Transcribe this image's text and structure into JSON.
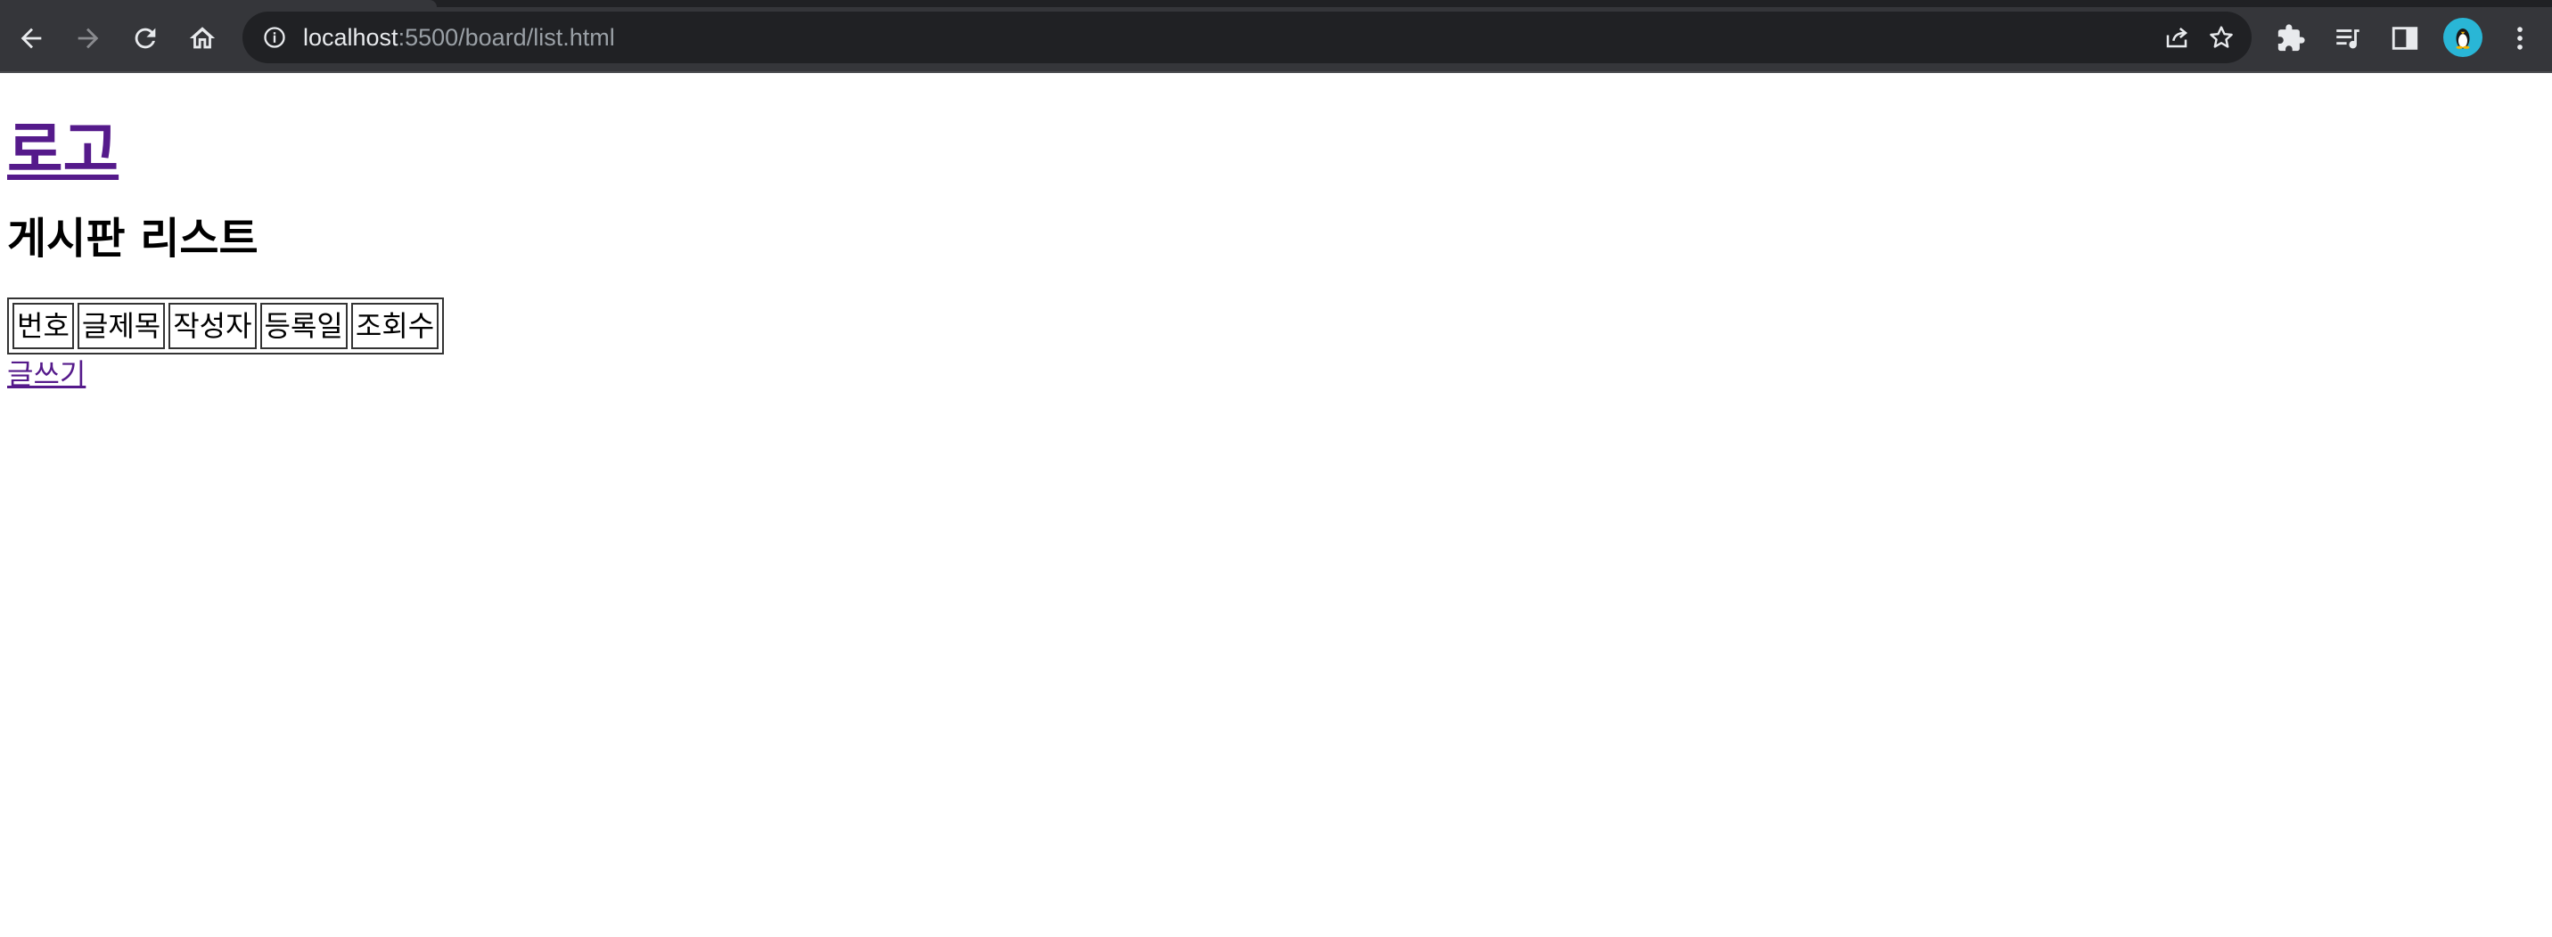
{
  "browser": {
    "url_host": "localhost",
    "url_rest": ":5500/board/list.html",
    "colors": {
      "chrome": "#35363a",
      "omnibox": "#202124",
      "icon": "#e8eaed",
      "avatar": "#29b6d6"
    }
  },
  "page": {
    "logo_text": "로고",
    "title": "게시판 리스트",
    "table": {
      "headers": [
        "번호",
        "글제목",
        "작성자",
        "등록일",
        "조회수"
      ],
      "rows": []
    },
    "write_link": "글쓰기",
    "colors": {
      "visited_link": "#551a8b"
    }
  }
}
